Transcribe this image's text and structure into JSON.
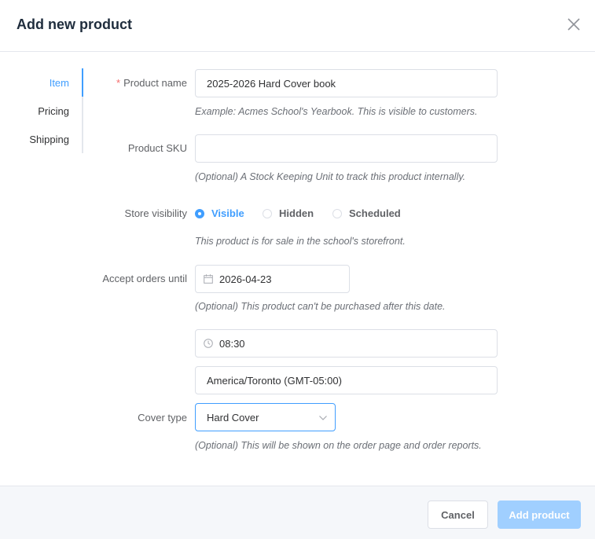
{
  "dialog": {
    "title": "Add new product"
  },
  "nav": {
    "items": [
      {
        "label": "Item"
      },
      {
        "label": "Pricing"
      },
      {
        "label": "Shipping"
      }
    ]
  },
  "form": {
    "product_name": {
      "label": "Product name",
      "required_mark": "*",
      "value": "2025-2026 Hard Cover book",
      "hint": "Example: Acmes School's Yearbook. This is visible to customers."
    },
    "product_sku": {
      "label": "Product SKU",
      "value": "",
      "hint": "(Optional) A Stock Keeping Unit to track this product internally."
    },
    "store_visibility": {
      "label": "Store visibility",
      "options": [
        {
          "label": "Visible"
        },
        {
          "label": "Hidden"
        },
        {
          "label": "Scheduled"
        }
      ],
      "selected": "Visible",
      "hint": "This product is for sale in the school's storefront."
    },
    "accept_orders_until": {
      "label": "Accept orders until",
      "date": "2026-04-23",
      "hint": "(Optional) This product can't be purchased after this date.",
      "time": "08:30",
      "timezone": "America/Toronto (GMT-05:00)"
    },
    "cover_type": {
      "label": "Cover type",
      "value": "Hard Cover",
      "hint": "(Optional) This will be shown on the order page and order reports."
    }
  },
  "footer": {
    "cancel_label": "Cancel",
    "submit_label": "Add product"
  },
  "colors": {
    "accent": "#409eff",
    "submit_disabled": "#a0cfff",
    "required": "#f56c6c"
  },
  "icons": {
    "close": "close-icon",
    "calendar": "calendar-icon",
    "clock": "clock-icon",
    "select_arrow": "chevron-down-icon"
  }
}
